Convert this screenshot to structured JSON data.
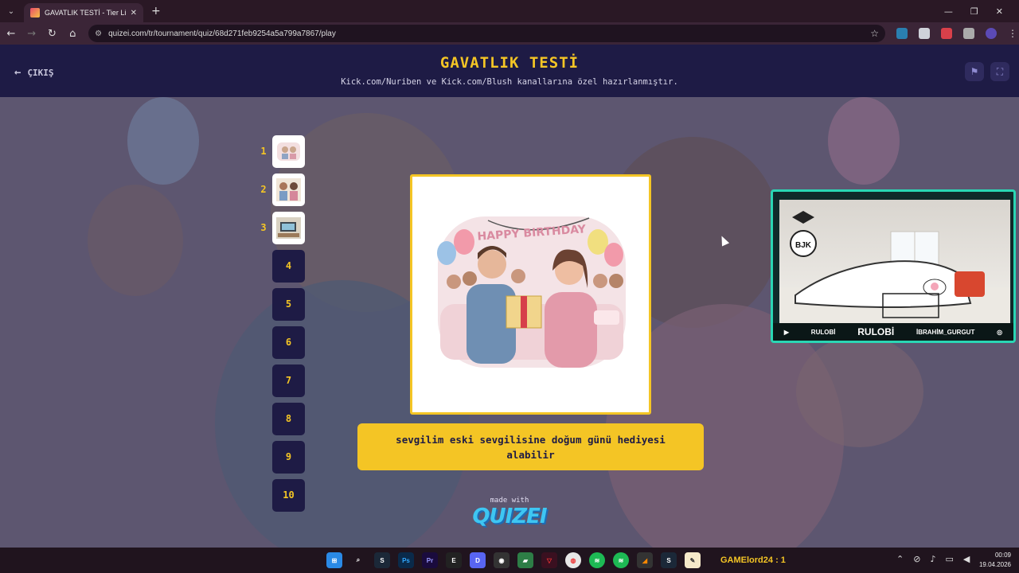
{
  "browser": {
    "tab_title": "GAVATLIK TESTİ - Tier List, Kör",
    "url": "quizei.com/tr/tournament/quiz/68d271feb9254a5a799a7867/play"
  },
  "header": {
    "exit_label": "ÇIKIŞ",
    "title": "GAVATLIK TESTİ",
    "subtitle": "Kick.com/Nuriben ve Kick.com/Blush kanallarına özel hazırlanmıştır."
  },
  "thumbnails": [
    {
      "num": "1",
      "box": ""
    },
    {
      "num": "2",
      "box": ""
    },
    {
      "num": "3",
      "box": ""
    },
    {
      "num": "",
      "box": "4"
    },
    {
      "num": "",
      "box": "5"
    },
    {
      "num": "",
      "box": "6"
    },
    {
      "num": "",
      "box": "7"
    },
    {
      "num": "",
      "box": "8"
    },
    {
      "num": "",
      "box": "9"
    },
    {
      "num": "",
      "box": "10"
    }
  ],
  "card": {
    "banner": "HAPPY BIRTHDAY"
  },
  "answer_text": "sevgilim eski sevgilisine doğum günü hediyesi alabilir",
  "footer": {
    "made_with": "made with",
    "brand": "QUIZEI"
  },
  "overlay": {
    "left_name": "RULOBİ",
    "center_name": "RULOBİ",
    "right_name": "İBRAHİM_GURGUT"
  },
  "taskbar": {
    "label": "GAMElord24 : 1",
    "time": "00:09",
    "date": "19.04.2026"
  },
  "colors": {
    "accent": "#f4c525",
    "header_bg": "#1e1b45"
  }
}
